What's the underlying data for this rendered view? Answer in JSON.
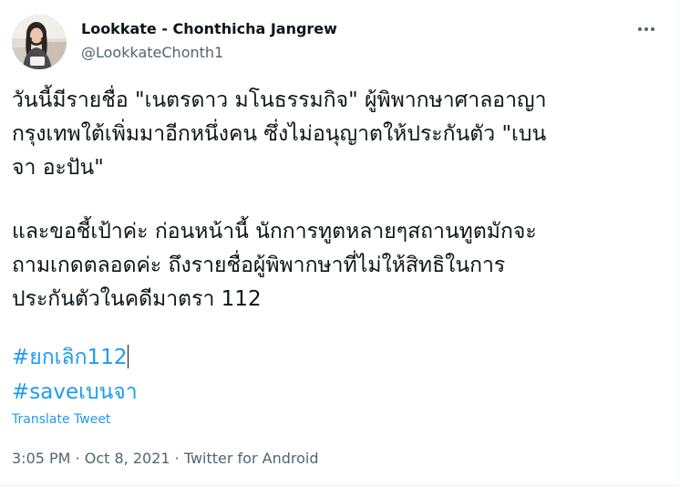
{
  "tweet": {
    "author": {
      "display_name": "Lookkate - Chonthicha Jangrew",
      "handle": "@LookkateChonth1"
    },
    "text_lines": [
      "วันนี้มีรายชื่อ \"เนตรดาว มโนธรรมกิจ\" ผู้พิพากษาศาลอาญา",
      "กรุงเทพใต้เพิ่มมาอีกหนึ่งคน ซึ่งไม่อนุญาตให้ประกันตัว \"เบน",
      "จา อะปัน\"",
      "และขอชี้เป้าค่ะ ก่อนหน้านี้ นักการทูตหลายๆสถานทูตมักจะ",
      "ถามเกดตลอดค่ะ ถึงรายชื่อผู้พิพากษาที่ไม่ให้สิทธิในการ",
      "ประกันตัวในคดีมาตรา 112"
    ],
    "hashtags": [
      "#ยกเลิก112",
      "#saveเบนจา"
    ],
    "translate_label": "Translate Tweet",
    "time": "3:05 PM",
    "date": "Oct 8, 2021",
    "source": "Twitter for Android",
    "separator": " · "
  },
  "icons": {
    "more": "more-horizontal-icon",
    "avatar": "profile-photo"
  },
  "colors": {
    "link": "#1d9bf0",
    "text": "#0f1419",
    "secondary": "#536471"
  }
}
